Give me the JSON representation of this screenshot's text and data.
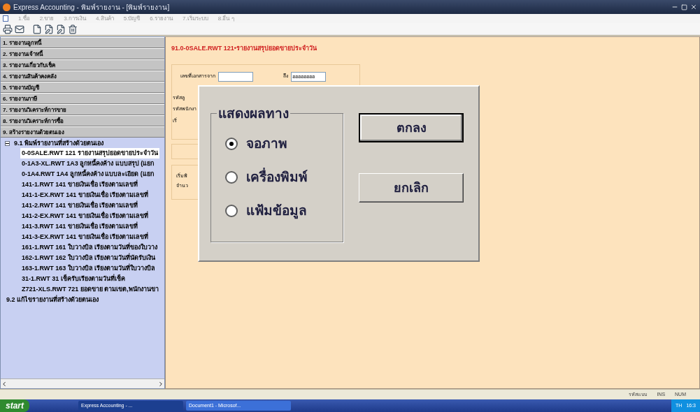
{
  "window": {
    "title": "Express Accounting - พิมพ์รายงาน - [พิมพ์รายงาน]"
  },
  "menu": [
    "1.ซื้อ",
    "2.ขาย",
    "3.การเงิน",
    "4.สินค้า",
    "5.บัญชี",
    "6.รายงาน",
    "7.เริ่มระบบ",
    "8.อื่น ๆ"
  ],
  "sidebar": {
    "groups": [
      "1. รายงานลูกหนี้",
      "2. รายงานเจ้าหนี้",
      "3. รายงานเกี่ยวกับเช็ค",
      "4. รายงานสินค้าคงคลัง",
      "5. รายงานบัญชี",
      "6. รายงานภาษี",
      "7. รายงานวิเคราะห์การขาย",
      "8. รายงานวิเคราะห์การซื้อ",
      "9. สร้างรายงานด้วยตนเอง"
    ],
    "tree": [
      {
        "label": "9.1 พิมพ์รายงานที่สร้างด้วยตนเอง",
        "expanded": true,
        "selected": false,
        "children": [
          {
            "label": "0-0SALE.RWT  121 รายงานสรุปยอดขายประจำวัน",
            "selected": true
          },
          {
            "label": "0-1A3-XL.RWT  1A3  ลูกหนี้คงค้าง แบบสรุป (แยก",
            "selected": false
          },
          {
            "label": "0-1A4.RWT  1A4  ลูกหนี้คงค้าง แบบละเอียด (แยก",
            "selected": false
          },
          {
            "label": "141-1.RWT  141  ขายเงินเชื่อ เรียงตามเลขที่",
            "selected": false
          },
          {
            "label": "141-1-EX.RWT  141  ขายเงินเชื่อ เรียงตามเลขที่",
            "selected": false
          },
          {
            "label": "141-2.RWT  141  ขายเงินเชื่อ เรียงตามเลขที่",
            "selected": false
          },
          {
            "label": "141-2-EX.RWT  141  ขายเงินเชื่อ เรียงตามเลขที่",
            "selected": false
          },
          {
            "label": "141-3.RWT  141  ขายเงินเชื่อ เรียงตามเลขที่",
            "selected": false
          },
          {
            "label": "141-3-EX.RWT  141  ขายเงินเชื่อ เรียงตามเลขที่",
            "selected": false
          },
          {
            "label": "161-1.RWT  161  ใบวางบิล เรียงตามวันที่ของใบวาง",
            "selected": false
          },
          {
            "label": "162-1.RWT  162  ใบวางบิล เรียงตามวันที่นัดรับเงิน",
            "selected": false
          },
          {
            "label": "163-1.RWT  163  ใบวางบิล เรียงตามวันที่ใบวางบิล",
            "selected": false
          },
          {
            "label": "31-1.RWT  31  เช็ครับเรียงตามวันที่เช็ค",
            "selected": false
          },
          {
            "label": "Z721-XLS.RWT  721  ยอดขาย ตามเขต,พนักงานขา",
            "selected": false
          }
        ]
      },
      {
        "label": "9.2 แก้ไขรายงานที่สร้างด้วยตนเอง",
        "selected": false
      }
    ]
  },
  "report": {
    "title": "91.0-0SALE.RWT  121•รายงานสรุปยอดขายประจำวัน",
    "doc_from_label": "เลขที่เอกสารจาก",
    "doc_to_label": "ถึง",
    "doc_to_value": "ฮฮฮฮฮฮฮฮ",
    "side_labels": [
      "รหัสลู",
      "รหัสพนักงา",
      "เริ่"
    ],
    "lower_labels": [
      "เริ่มพิ",
      "จำนว"
    ]
  },
  "dialog": {
    "group_title": "แสดงผลทาง",
    "options": [
      {
        "label": "จอภาพ",
        "selected": true
      },
      {
        "label": "เครื่องพิมพ์",
        "selected": false
      },
      {
        "label": "แฟ้มข้อมูล",
        "selected": false
      }
    ],
    "buttons": [
      {
        "label": "ตกลง",
        "default": true
      },
      {
        "label": "ยกเลิก",
        "default": false
      }
    ]
  },
  "status_bar": [
    "รหัสแบบ",
    "INS",
    "NUM"
  ],
  "taskbar": {
    "start": "start",
    "tasks": [
      {
        "label": "Express Accounting - ...",
        "selected": true
      },
      {
        "label": "Document1 - Microsof...",
        "selected": false
      }
    ],
    "lang": "TH",
    "clock": "16:3"
  }
}
